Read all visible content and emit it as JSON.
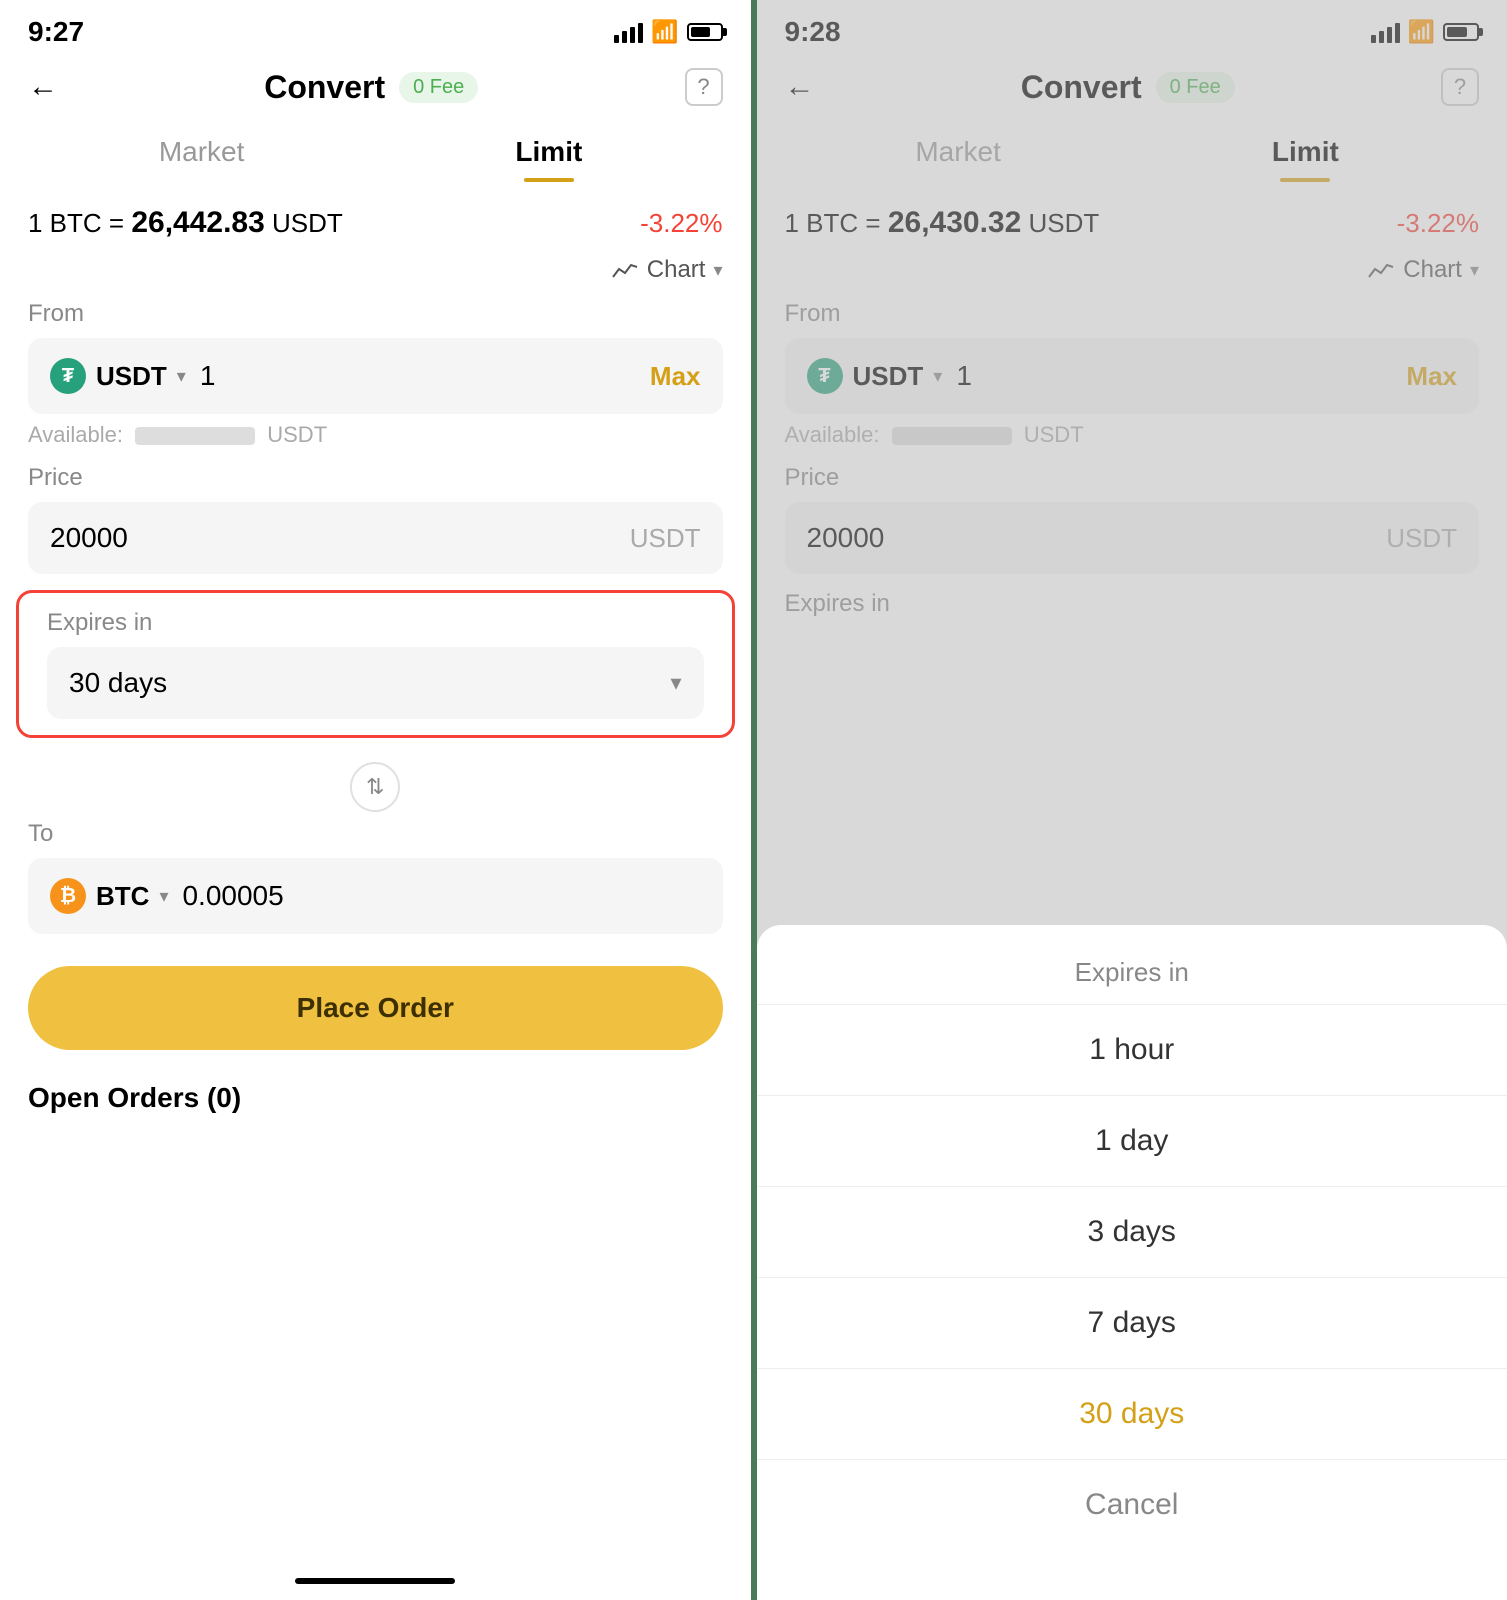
{
  "left_screen": {
    "status_time": "9:27",
    "nav": {
      "back_label": "←",
      "title": "Convert",
      "fee_badge": "0 Fee",
      "help": "?"
    },
    "tabs": {
      "market": "Market",
      "limit": "Limit"
    },
    "price_line": {
      "prefix": "1 BTC =",
      "value": "26,442.83",
      "suffix": "USDT",
      "change": "-3.22%"
    },
    "chart_label": "Chart",
    "from_label": "From",
    "from_currency": "USDT",
    "from_value": "1",
    "max_label": "Max",
    "available_label": "Available:",
    "available_suffix": "USDT",
    "price_label": "Price",
    "price_value": "20000",
    "price_currency": "USDT",
    "expires_label": "Expires in",
    "expires_value": "30 days",
    "to_label": "To",
    "to_currency": "BTC",
    "to_value": "0.00005",
    "place_order_label": "Place Order",
    "open_orders_label": "Open Orders (0)"
  },
  "right_screen": {
    "status_time": "9:28",
    "nav": {
      "back_label": "←",
      "title": "Convert",
      "fee_badge": "0 Fee",
      "help": "?"
    },
    "tabs": {
      "market": "Market",
      "limit": "Limit"
    },
    "price_line": {
      "prefix": "1 BTC =",
      "value": "26,430.32",
      "suffix": "USDT",
      "change": "-3.22%"
    },
    "chart_label": "Chart",
    "from_label": "From",
    "from_currency": "USDT",
    "from_value": "1",
    "max_label": "Max",
    "available_label": "Available:",
    "available_suffix": "USDT",
    "price_label": "Price",
    "price_value": "20000",
    "price_currency": "USDT",
    "expires_label": "Expires in",
    "bottom_sheet": {
      "title": "Expires in",
      "items": [
        "1 hour",
        "1 day",
        "3 days",
        "7 days",
        "30 days",
        "Cancel"
      ],
      "selected": "30 days"
    }
  }
}
